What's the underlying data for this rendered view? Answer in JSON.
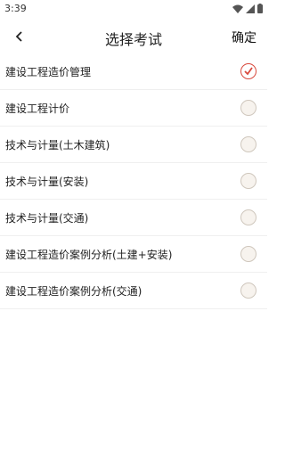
{
  "status": {
    "time": "3:39"
  },
  "header": {
    "title": "选择考试",
    "confirm_label": "确定"
  },
  "options": [
    {
      "label": "建设工程造价管理",
      "checked": true
    },
    {
      "label": "建设工程计价",
      "checked": false
    },
    {
      "label": "技术与计量(土木建筑)",
      "checked": false
    },
    {
      "label": "技术与计量(安装)",
      "checked": false
    },
    {
      "label": "技术与计量(交通)",
      "checked": false
    },
    {
      "label": "建设工程造价案例分析(土建+安装)",
      "checked": false
    },
    {
      "label": "建设工程造价案例分析(交通)",
      "checked": false
    }
  ],
  "colors": {
    "accent": "#d8493d",
    "radio_border": "#cfc7bd",
    "radio_fill": "#f7f3ee"
  }
}
